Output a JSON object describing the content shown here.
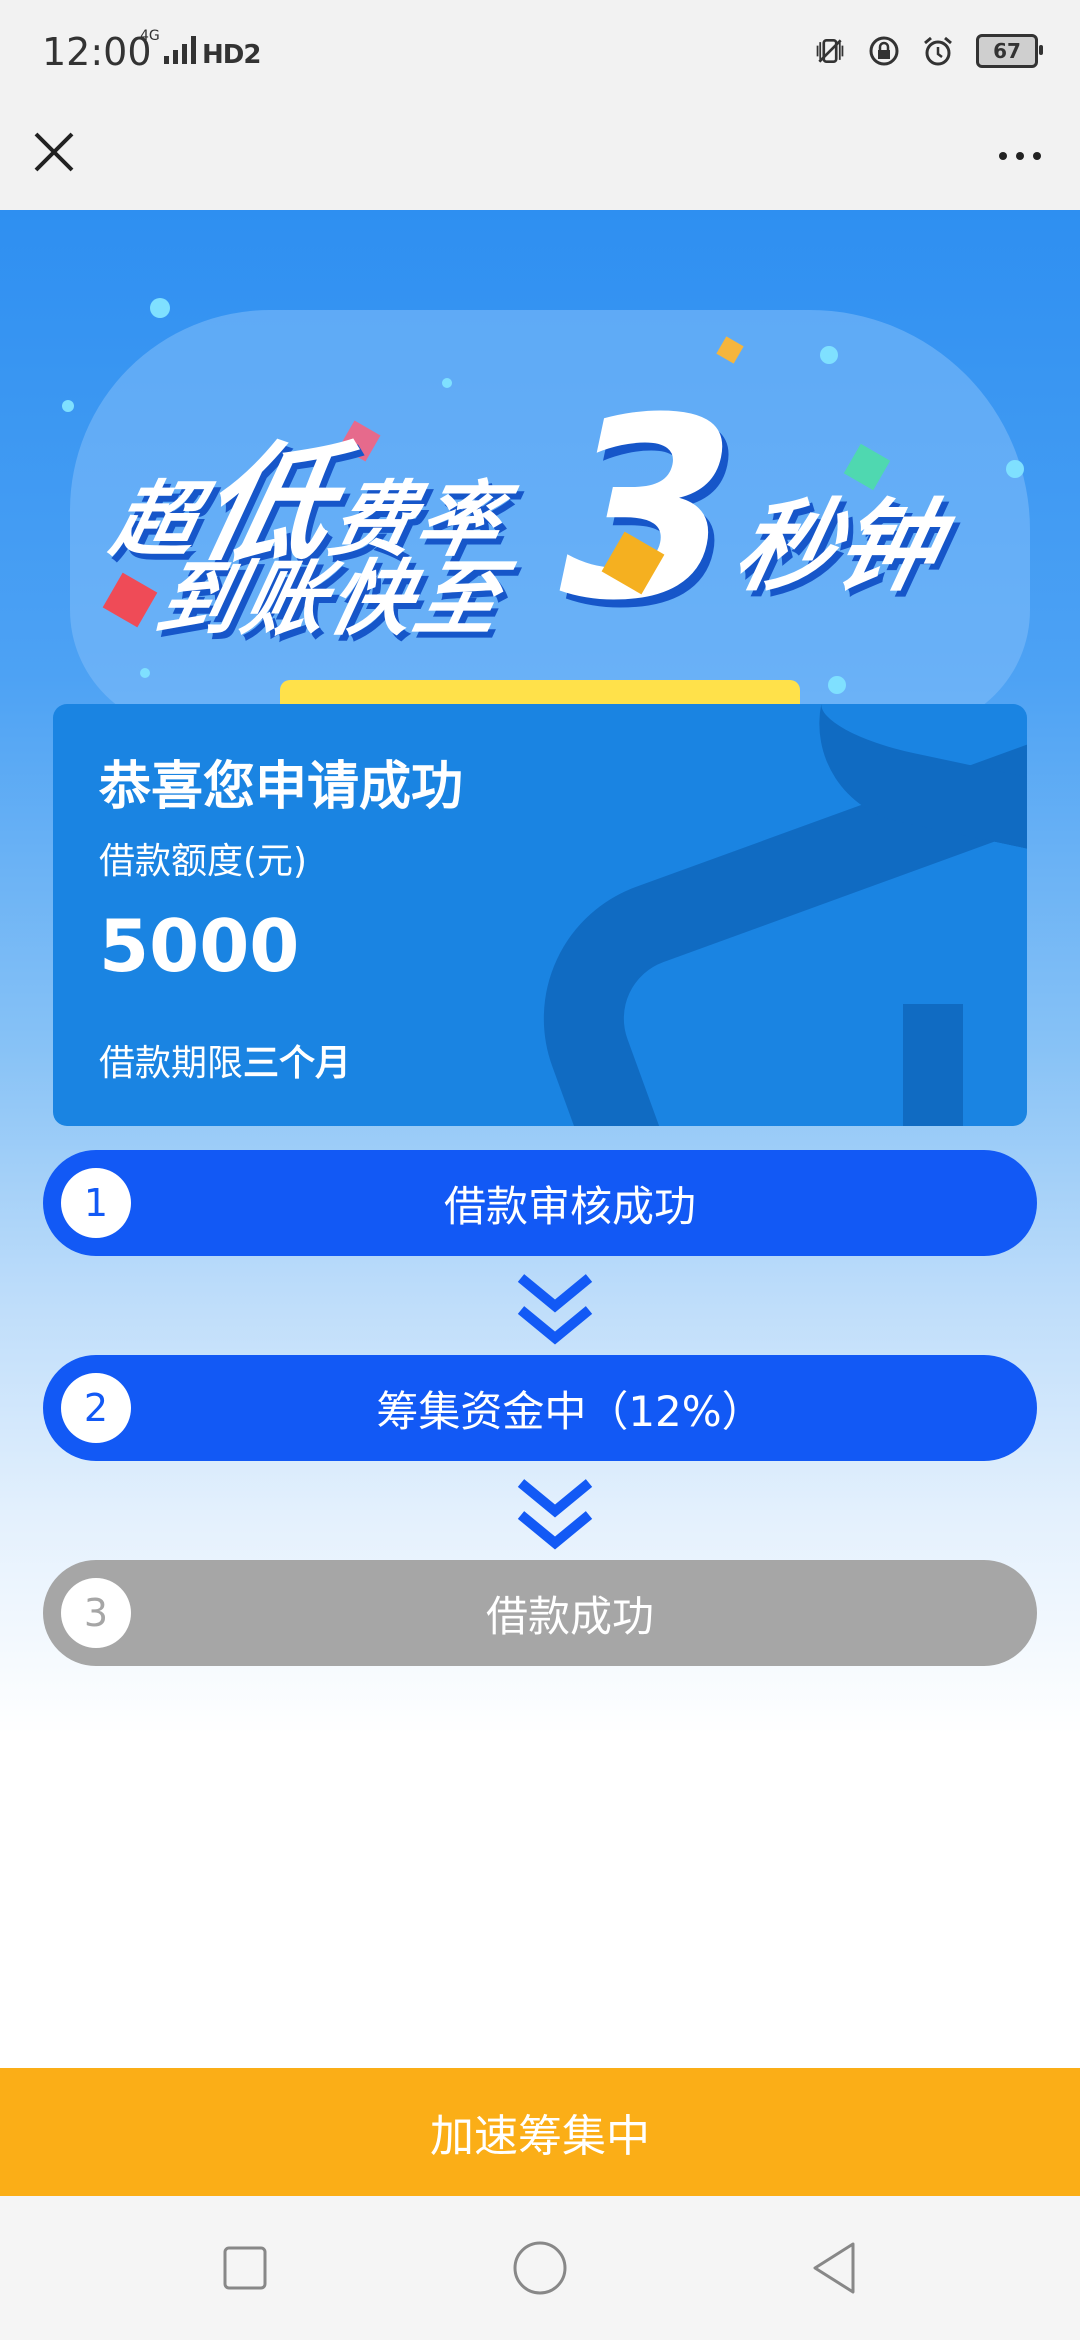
{
  "status_bar": {
    "time": "12:00",
    "network_tag": "4G",
    "hd_label": "HD2",
    "battery": "67",
    "icons": [
      "vibrate-icon",
      "lock-icon",
      "alarm-icon",
      "battery-icon"
    ]
  },
  "nav": {
    "close_icon": "close-icon",
    "more_icon": "more-icon"
  },
  "banner": {
    "line1_a": "超",
    "line1_big": "低",
    "line1_b": "费率",
    "line2": "到账快至",
    "number": "3",
    "suffix": "秒钟"
  },
  "card": {
    "title": "恭喜您申请成功",
    "amount_label": "借款额度(元)",
    "amount": "5000",
    "term_label": "借款期限",
    "term_value": "三个月"
  },
  "steps": [
    {
      "num": "1",
      "label": "借款审核成功",
      "state": "active"
    },
    {
      "num": "2",
      "label": "筹集资金中（12%）",
      "state": "active"
    },
    {
      "num": "3",
      "label": "借款成功",
      "state": "inactive"
    }
  ],
  "action": {
    "label": "加速筹集中"
  },
  "colors": {
    "primary_blue": "#1259f5",
    "card_blue": "#1a84e2",
    "inactive_gray": "#a6a6a6",
    "action_orange": "#fbae17"
  },
  "system_nav": [
    "recent-apps-icon",
    "home-icon",
    "back-icon"
  ]
}
